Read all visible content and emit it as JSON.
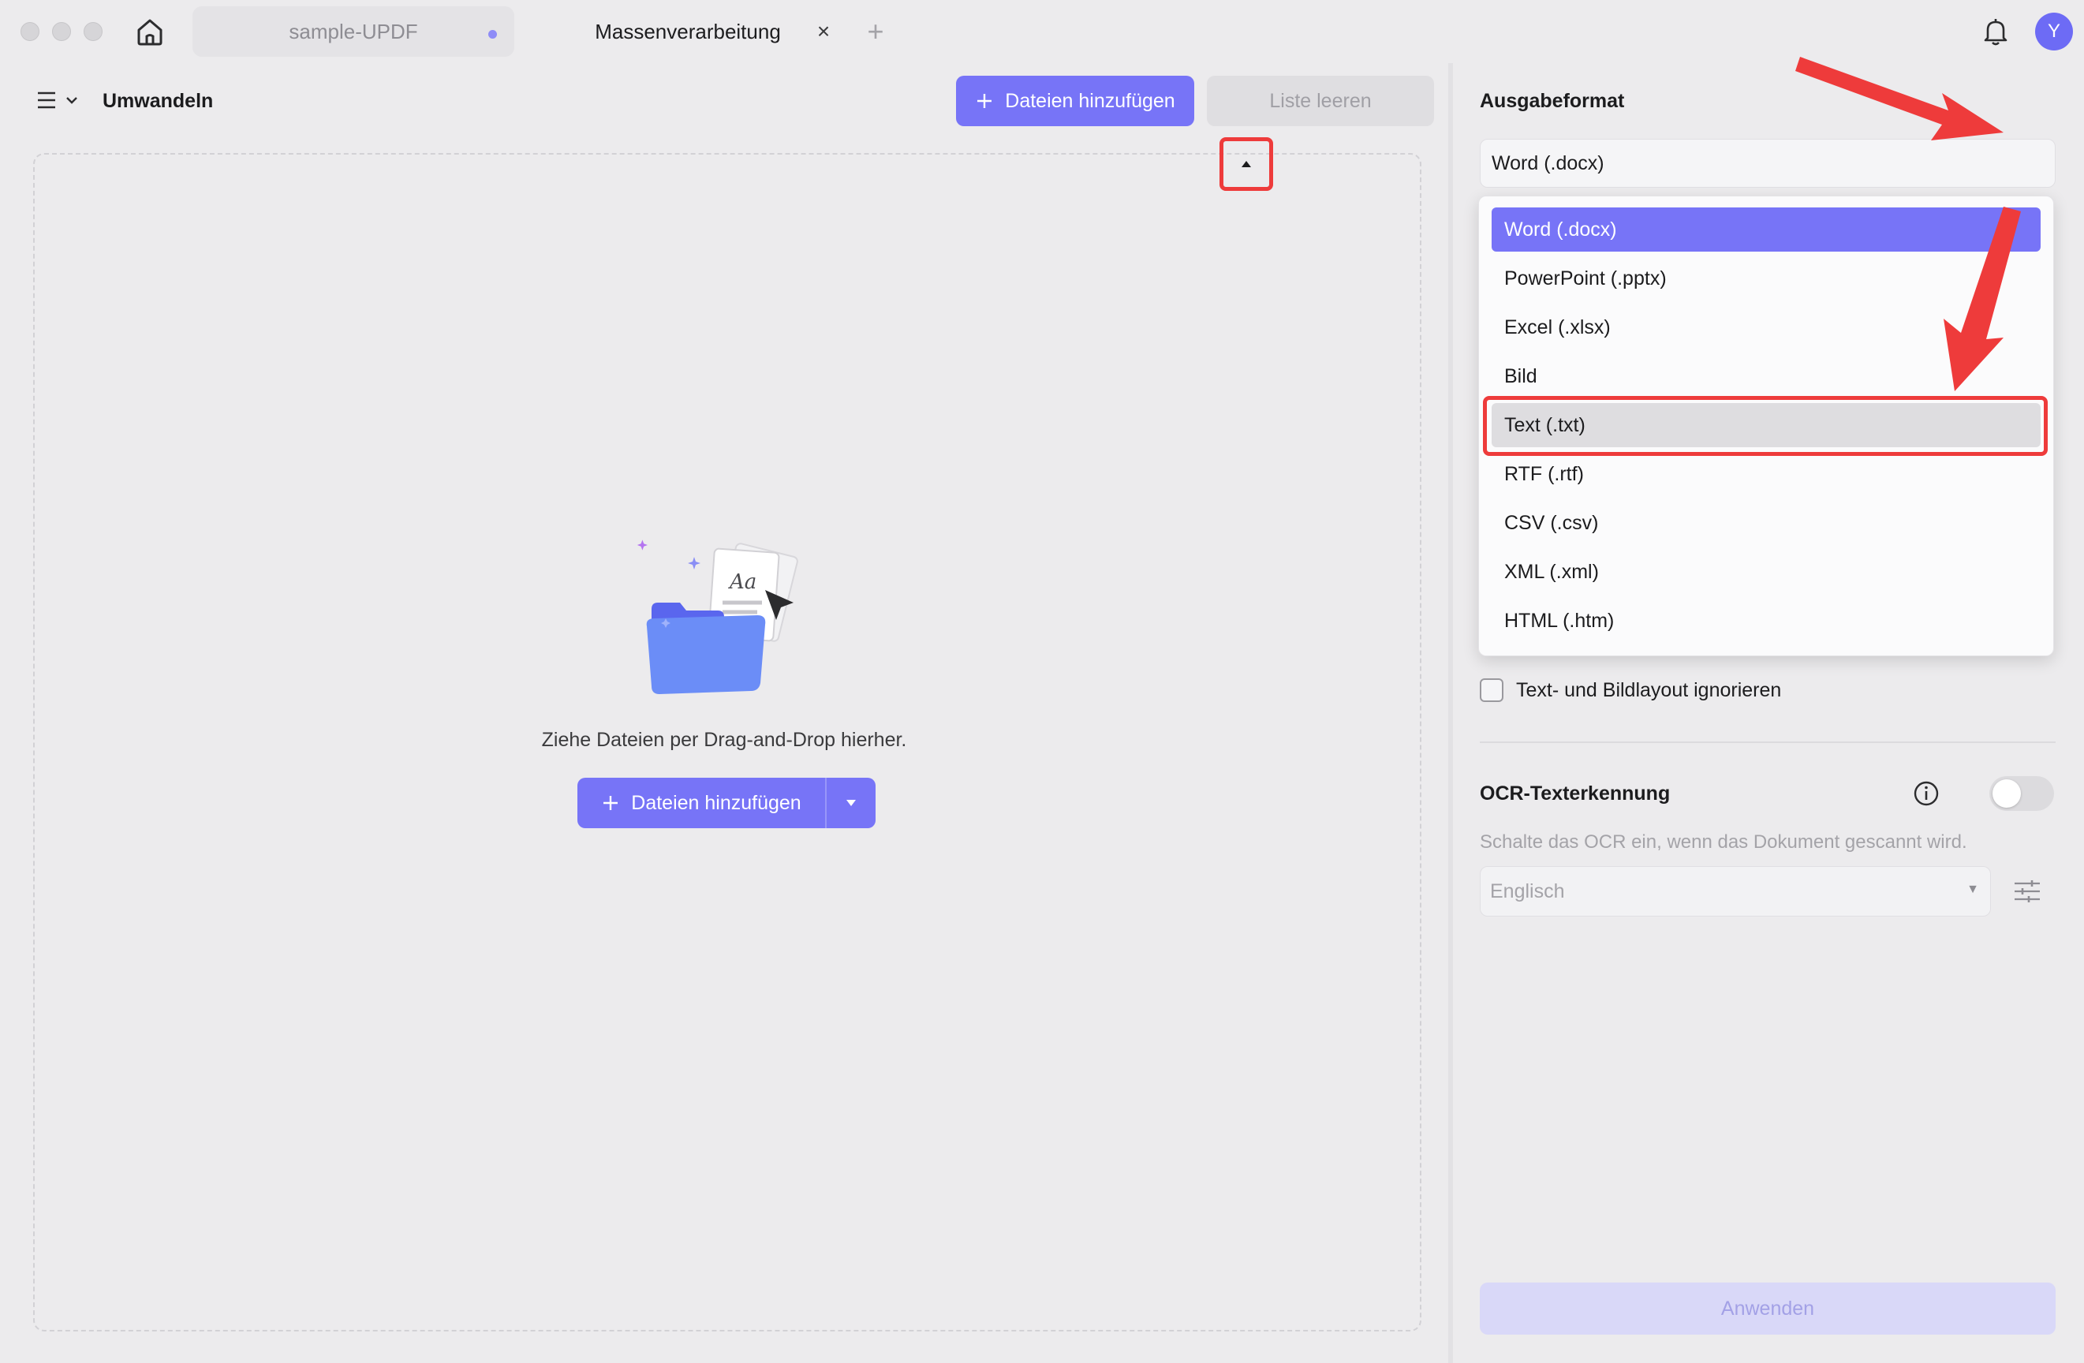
{
  "titlebar": {
    "tabs": [
      {
        "label": "sample-UPDF",
        "active": false,
        "unsaved": true
      },
      {
        "label": "Massenverarbeitung",
        "active": true
      }
    ],
    "avatar_initial": "Y"
  },
  "left_panel": {
    "title": "Umwandeln",
    "add_files_label": "Dateien hinzufügen",
    "clear_list_label": "Liste leeren",
    "drop_hint": "Ziehe Dateien per Drag-and-Drop hierher.",
    "add_files_center_label": "Dateien hinzufügen"
  },
  "right_panel": {
    "output_format_label": "Ausgabeformat",
    "selected_format": "Word (.docx)",
    "format_options": [
      "Word (.docx)",
      "PowerPoint (.pptx)",
      "Excel (.xlsx)",
      "Bild",
      "Text (.txt)",
      "RTF (.rtf)",
      "CSV (.csv)",
      "XML (.xml)",
      "HTML (.htm)"
    ],
    "highlighted_option": "Text (.txt)",
    "ignore_layout_label": "Text- und Bildlayout ignorieren",
    "ignore_layout_checked": false,
    "ocr_title": "OCR-Texterkennung",
    "ocr_enabled": false,
    "ocr_hint": "Schalte das OCR ein, wenn das Dokument gescannt wird.",
    "ocr_language": "Englisch",
    "apply_label": "Anwenden"
  },
  "colors": {
    "accent": "#7774f7",
    "annotation_red": "#ee3b3b",
    "background": "#ecebed"
  }
}
